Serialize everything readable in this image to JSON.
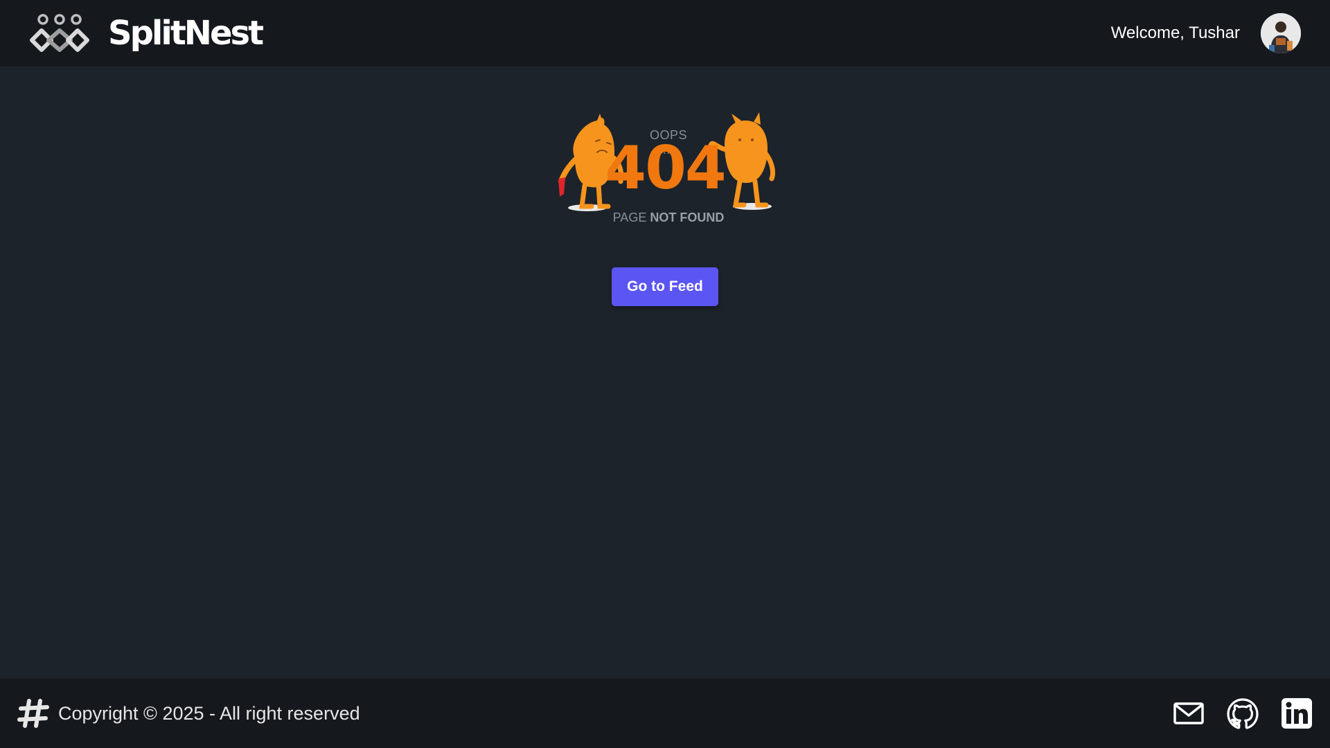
{
  "header": {
    "brand_name": "SplitNest",
    "welcome_text": "Welcome, Tushar",
    "logo_icon": "chain-links-logo",
    "avatar_icon": "user-avatar"
  },
  "main": {
    "oops_text": "OOPS ...",
    "error_code": "404",
    "page_text": "PAGE",
    "not_found_text": "NOT FOUND",
    "go_to_feed_label": "Go to Feed",
    "illustration": "two-orange-monsters-404"
  },
  "footer": {
    "copyright": "Copyright © 2025 - All right reserved",
    "icons": [
      "hash-icon",
      "mail-icon",
      "github-icon",
      "linkedin-icon"
    ]
  },
  "colors": {
    "page_bg": "#1d232a",
    "bar_bg": "#15191e",
    "accent_button": "#5b55f4",
    "error_orange": "#f0780f",
    "muted_text": "#8a8f96"
  }
}
